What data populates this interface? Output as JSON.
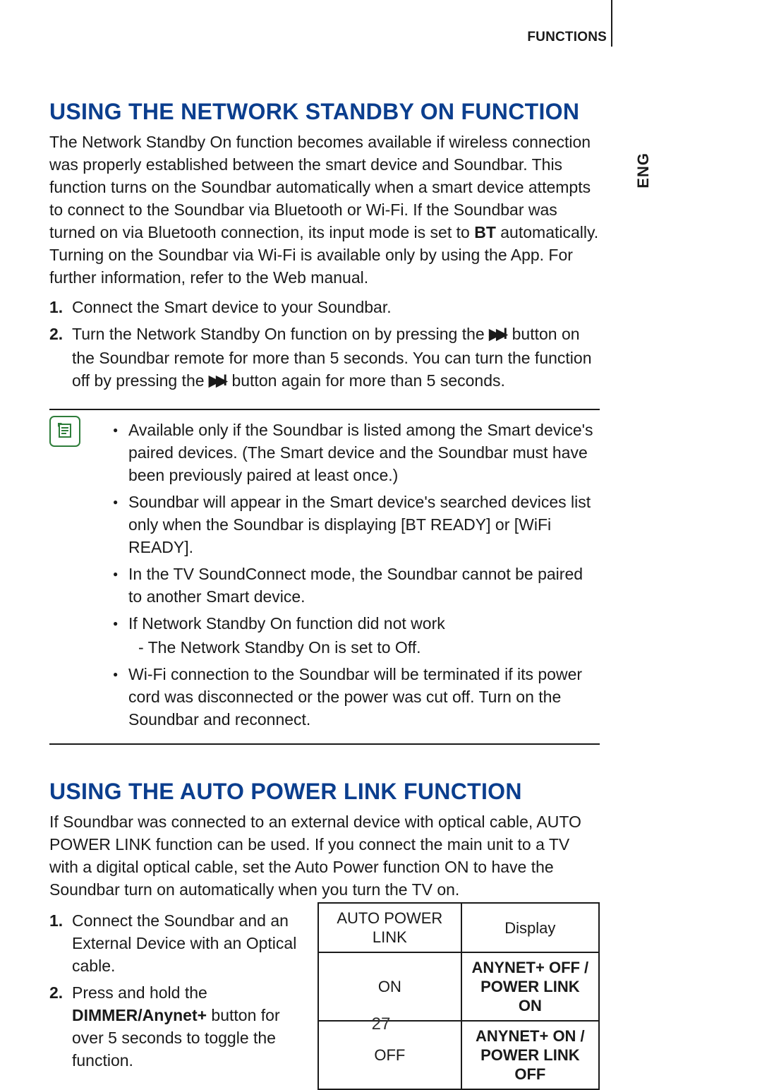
{
  "header": {
    "section_label": "FUNCTIONS",
    "page_number": "27",
    "language_tab": "ENG"
  },
  "section1": {
    "title": "USING THE NETWORK STANDBY ON FUNCTION",
    "intro_part1": "The Network Standby On function becomes available if wireless connection was properly established between the smart device and Soundbar. This function turns on the Soundbar automatically when a smart device attempts to connect to the Soundbar via Bluetooth or Wi-Fi. If the Soundbar was turned on via Bluetooth connection, its input mode is set to ",
    "intro_bold_bt": "BT",
    "intro_part2": " automatically. Turning on the Soundbar via Wi-Fi is available only by using the App. For further information, refer to the Web manual.",
    "steps": [
      {
        "num": "1.",
        "text": "Connect the Smart device to your Soundbar."
      },
      {
        "num": "2.",
        "pre": "Turn the Network Standby On function on by pressing the ",
        "mid": " button on the Soundbar remote for more than 5 seconds. You can turn the function off by pressing the ",
        "post": " button again for more than 5 seconds."
      }
    ],
    "notes": [
      "Available only if the Soundbar is listed among the Smart device's paired devices. (The Smart device and the Soundbar must have been previously paired at least once.)",
      "Soundbar will appear in the Smart device's searched devices list only when the Soundbar is displaying [BT READY] or [WiFi READY].",
      "In the TV SoundConnect mode, the Soundbar cannot be paired to another Smart device.",
      "If Network Standby On function did not work",
      "Wi-Fi connection to the Soundbar will be terminated if its power cord was disconnected or the power was cut off. Turn on the Soundbar and reconnect."
    ],
    "note4_sub": "- The Network Standby On is set to Off."
  },
  "section2": {
    "title": "USING THE AUTO POWER LINK FUNCTION",
    "intro": "If Soundbar was connected to an external device with optical cable, AUTO POWER LINK function can be used. If you connect the main unit to a TV with a digital optical cable, set the Auto Power function ON to have the Soundbar turn on automatically when you turn the TV on.",
    "steps": [
      {
        "num": "1.",
        "text": "Connect the Soundbar and an External Device with an Optical cable."
      },
      {
        "num": "2.",
        "pre": "Press and hold the ",
        "bold": "DIMMER/Anynet+",
        "post": " button for over 5 seconds to toggle the function."
      }
    ],
    "table": {
      "h1": "AUTO POWER LINK",
      "h2": "Display",
      "r1c1": "ON",
      "r1c2a": "ANYNET+ OFF /",
      "r1c2b": "POWER LINK ON",
      "r2c1": "OFF",
      "r2c2a": "ANYNET+ ON /",
      "r2c2b": "POWER LINK OFF"
    }
  }
}
